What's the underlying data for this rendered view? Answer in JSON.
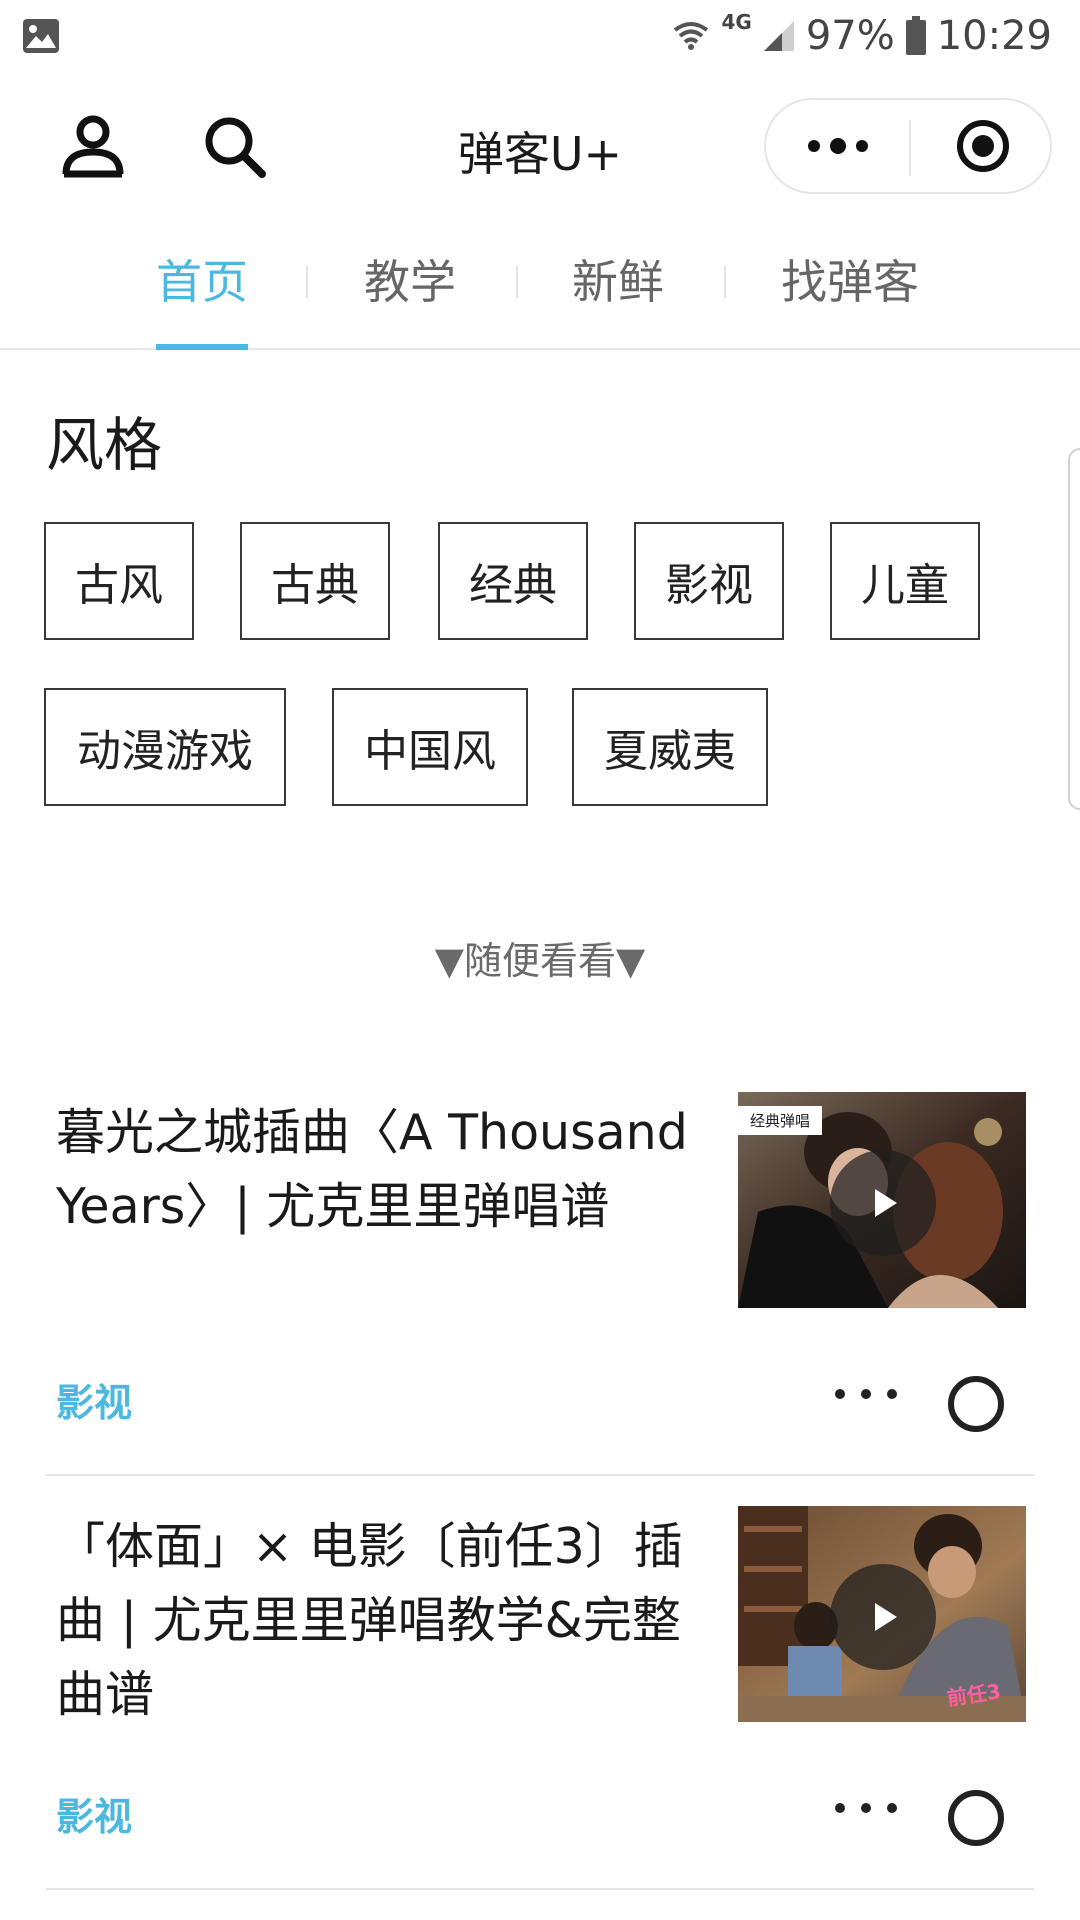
{
  "status_bar": {
    "network": "4G",
    "battery": "97%",
    "time": "10:29"
  },
  "header": {
    "title": "弹客U+"
  },
  "tabs": [
    {
      "label": "首页",
      "active": true
    },
    {
      "label": "教学",
      "active": false
    },
    {
      "label": "新鲜",
      "active": false
    },
    {
      "label": "找弹客",
      "active": false
    }
  ],
  "styles_section": {
    "title": "风格",
    "tags": [
      "古风",
      "古典",
      "经典",
      "影视",
      "儿童",
      "动漫游戏",
      "中国风",
      "夏威夷"
    ]
  },
  "browse_label": "▼随便看看▼",
  "feed": [
    {
      "title": "暮光之城插曲〈A Thousand Years〉| 尤克里里弹唱谱",
      "category": "影视",
      "thumb_badge": "经典弹唱"
    },
    {
      "title": "「体面」× 电影〔前任3〕插曲 | 尤克里里弹唱教学&完整曲谱",
      "category": "影视",
      "thumb_badge": ""
    }
  ],
  "colors": {
    "accent": "#4bb8e2",
    "text": "#1a1a1a",
    "border": "#3a3a3a"
  }
}
